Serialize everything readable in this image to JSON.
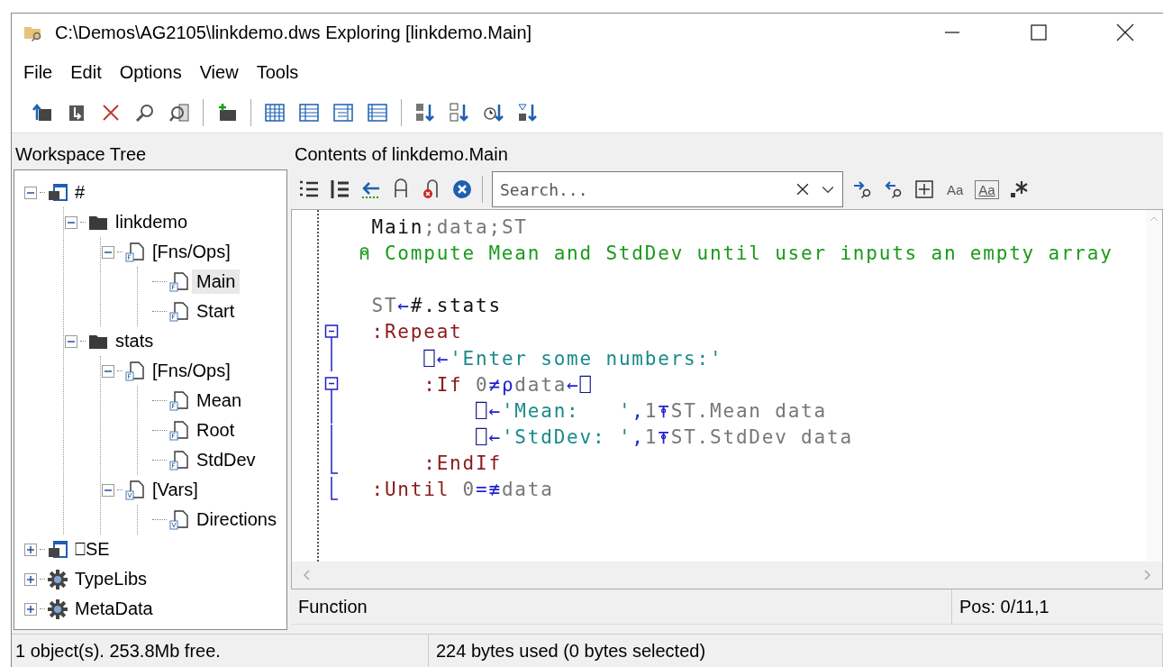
{
  "window": {
    "title": "C:\\Demos\\AG2105\\linkdemo.dws Exploring [linkdemo.Main]"
  },
  "menu": [
    "File",
    "Edit",
    "Options",
    "View",
    "Tools"
  ],
  "tree_panel": {
    "title": "Workspace Tree",
    "items": [
      {
        "label": "#",
        "kind": "workspace",
        "selected": false,
        "expanded": true,
        "children": [
          {
            "label": "linkdemo",
            "kind": "folder",
            "selected": false,
            "expanded": true,
            "children": [
              {
                "label": "[Fns/Ops]",
                "kind": "functions",
                "selected": false,
                "expanded": true,
                "children": [
                  {
                    "label": "Main",
                    "kind": "function",
                    "selected": true
                  },
                  {
                    "label": "Start",
                    "kind": "function",
                    "selected": false
                  }
                ]
              }
            ]
          },
          {
            "label": "stats",
            "kind": "folder",
            "selected": false,
            "expanded": true,
            "children": [
              {
                "label": "[Fns/Ops]",
                "kind": "functions",
                "selected": false,
                "expanded": true,
                "children": [
                  {
                    "label": "Mean",
                    "kind": "function",
                    "selected": false
                  },
                  {
                    "label": "Root",
                    "kind": "function",
                    "selected": false
                  },
                  {
                    "label": "StdDev",
                    "kind": "function",
                    "selected": false
                  }
                ]
              },
              {
                "label": "[Vars]",
                "kind": "variables",
                "selected": false,
                "expanded": true,
                "children": [
                  {
                    "label": "Directions",
                    "kind": "variable",
                    "selected": false
                  }
                ]
              }
            ]
          }
        ]
      },
      {
        "label": "⎕SE",
        "kind": "workspace",
        "selected": false,
        "expanded": false
      },
      {
        "label": "TypeLibs",
        "kind": "gear",
        "selected": false,
        "expanded": false
      },
      {
        "label": "MetaData",
        "kind": "gear",
        "selected": false,
        "expanded": false
      }
    ]
  },
  "contents_panel": {
    "title": "Contents of linkdemo.Main",
    "search": {
      "placeholder": "Search..."
    },
    "case_toggle": "Aa",
    "word_toggle": "Aa",
    "code": [
      {
        "kind": "plain",
        "tokens": [
          {
            "kind": "name",
            "text": " Main"
          },
          {
            "kind": "local",
            "text": ";data;ST"
          }
        ]
      },
      {
        "kind": "plain",
        "tokens": [
          {
            "kind": "comment",
            "text": "⍝ Compute Mean and StdDev until user inputs an empty array"
          }
        ]
      },
      {
        "kind": "plain"
      },
      {
        "kind": "plain",
        "tokens": [
          {
            "kind": "local",
            "text": " ST"
          },
          {
            "kind": "primitive",
            "text": "←"
          },
          {
            "kind": "name",
            "text": "#.stats"
          }
        ]
      },
      {
        "kind": "fold_start",
        "tokens": [
          {
            "kind": "keyword",
            "text": " :Repeat"
          }
        ]
      },
      {
        "kind": "fold_body",
        "tokens": [
          {
            "kind": "system",
            "text": "     ⎕"
          },
          {
            "kind": "primitive",
            "text": "←"
          },
          {
            "kind": "string",
            "text": "'Enter some numbers:'"
          }
        ]
      },
      {
        "kind": "fold_start",
        "tokens": [
          {
            "kind": "keyword",
            "text": "     :If"
          },
          {
            "kind": "local",
            "text": " 0"
          },
          {
            "kind": "primitive",
            "text": "≠⍴"
          },
          {
            "kind": "local",
            "text": "data"
          },
          {
            "kind": "primitive",
            "text": "←"
          },
          {
            "kind": "system",
            "text": "⎕"
          }
        ]
      },
      {
        "kind": "fold_body",
        "tokens": [
          {
            "kind": "system",
            "text": "         ⎕"
          },
          {
            "kind": "primitive",
            "text": "←"
          },
          {
            "kind": "string",
            "text": "'Mean:   '"
          },
          {
            "kind": "primitive",
            "text": ","
          },
          {
            "kind": "local",
            "text": "1"
          },
          {
            "kind": "primitive",
            "text": "⍕"
          },
          {
            "kind": "local",
            "text": "ST.Mean data"
          }
        ]
      },
      {
        "kind": "fold_body",
        "tokens": [
          {
            "kind": "system",
            "text": "         ⎕"
          },
          {
            "kind": "primitive",
            "text": "←"
          },
          {
            "kind": "string",
            "text": "'StdDev: '"
          },
          {
            "kind": "primitive",
            "text": ","
          },
          {
            "kind": "local",
            "text": "1"
          },
          {
            "kind": "primitive",
            "text": "⍕"
          },
          {
            "kind": "local",
            "text": "ST.StdDev data"
          }
        ]
      },
      {
        "kind": "fold_end",
        "tokens": [
          {
            "kind": "keyword",
            "text": "     :EndIf"
          }
        ]
      },
      {
        "kind": "fold_end",
        "tokens": [
          {
            "kind": "keyword",
            "text": " :Until"
          },
          {
            "kind": "local",
            "text": " 0"
          },
          {
            "kind": "primitive",
            "text": "=≢"
          },
          {
            "kind": "local",
            "text": "data"
          }
        ]
      }
    ],
    "status": {
      "type": "Function",
      "position": "Pos: 0/11,1"
    }
  },
  "status_bar": [
    "1 object(s). 253.8Mb free.",
    "224 bytes used (0 bytes selected)"
  ]
}
